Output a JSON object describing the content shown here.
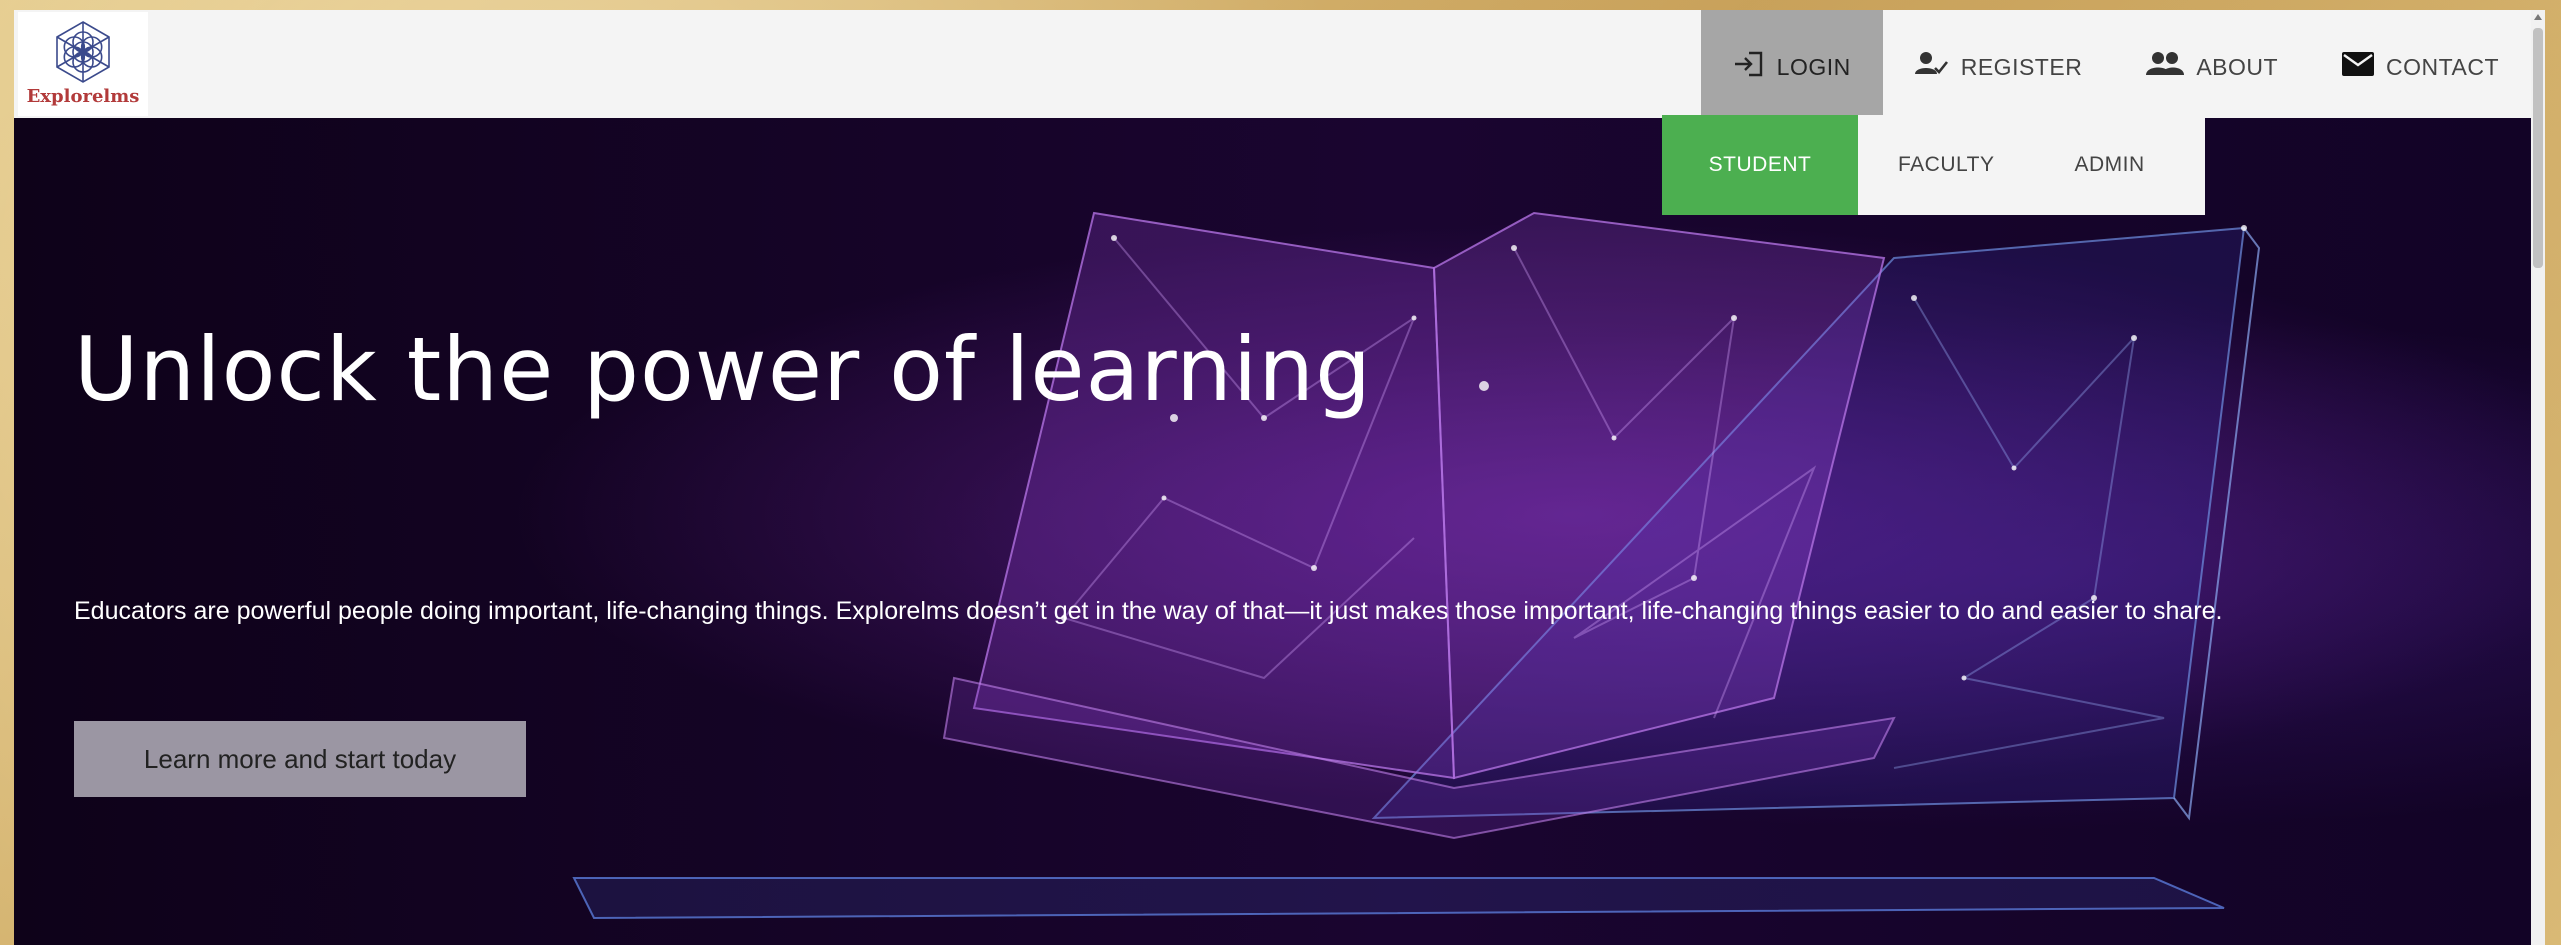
{
  "brand": {
    "name": "Explorelms",
    "logo_icon": "flower-of-life-icon",
    "logo_color": "#3b4a8c",
    "text_color": "#b23a3a"
  },
  "nav": {
    "items": [
      {
        "label": "LOGIN",
        "icon": "login-icon"
      },
      {
        "label": "REGISTER",
        "icon": "person-check-icon"
      },
      {
        "label": "ABOUT",
        "icon": "people-icon"
      },
      {
        "label": "CONTACT",
        "icon": "envelope-icon"
      }
    ],
    "active": "LOGIN"
  },
  "dropdown": {
    "items": [
      "STUDENT",
      "FACULTY",
      "ADMIN"
    ],
    "selected": "STUDENT",
    "selected_color": "#4caf50"
  },
  "hero": {
    "title": "Unlock the power of learning",
    "description": "Educators are powerful people doing important, life-changing things. Explorelms doesn’t get in the way of that—it just makes those important, life-changing things easier to do and easier to share.",
    "cta_label": "Learn more and start today",
    "cta_color": "#9b96a3"
  }
}
